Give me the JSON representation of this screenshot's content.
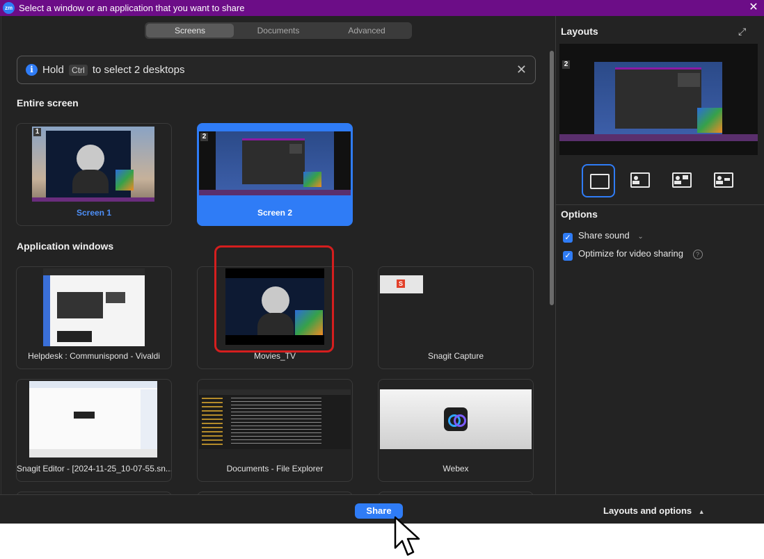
{
  "window": {
    "logo": "zm",
    "title": "Select a window or an application that you want to share",
    "close_icon": "close-icon"
  },
  "tabs": [
    {
      "label": "Screens",
      "active": true
    },
    {
      "label": "Documents",
      "active": false
    },
    {
      "label": "Advanced",
      "active": false
    }
  ],
  "info": {
    "prefix": "Hold",
    "key": "Ctrl",
    "suffix": "to select 2 desktops",
    "icon": "info-icon"
  },
  "entire_screen": {
    "heading": "Entire screen",
    "screens": [
      {
        "label": "Screen 1",
        "badge": "1",
        "selected": false
      },
      {
        "label": "Screen 2",
        "badge": "2",
        "selected": true
      }
    ]
  },
  "app_windows": {
    "heading": "Application windows",
    "items": [
      {
        "label": "Helpdesk : Communispond - Vivaldi"
      },
      {
        "label": "Movies_TV",
        "highlighted": true
      },
      {
        "label": "Snagit Capture",
        "thumb_text": "S"
      },
      {
        "label": "Snagit Editor - [2024-11-25_10-07-55.sn..."
      },
      {
        "label": "Documents - File Explorer"
      },
      {
        "label": "Webex"
      }
    ]
  },
  "layouts_panel": {
    "title": "Layouts",
    "preview_badge": "2",
    "options_title": "Options",
    "options": [
      {
        "label": "Share sound",
        "checked": true,
        "has_dropdown": true
      },
      {
        "label": "Optimize for video sharing",
        "checked": true,
        "has_help": true
      }
    ]
  },
  "footer": {
    "share_label": "Share",
    "layouts_toggle": "Layouts and options"
  },
  "colors": {
    "accent": "#2f7cf6",
    "titlebar": "#6c0d87",
    "highlight": "#d41e1e",
    "background": "#232323"
  }
}
